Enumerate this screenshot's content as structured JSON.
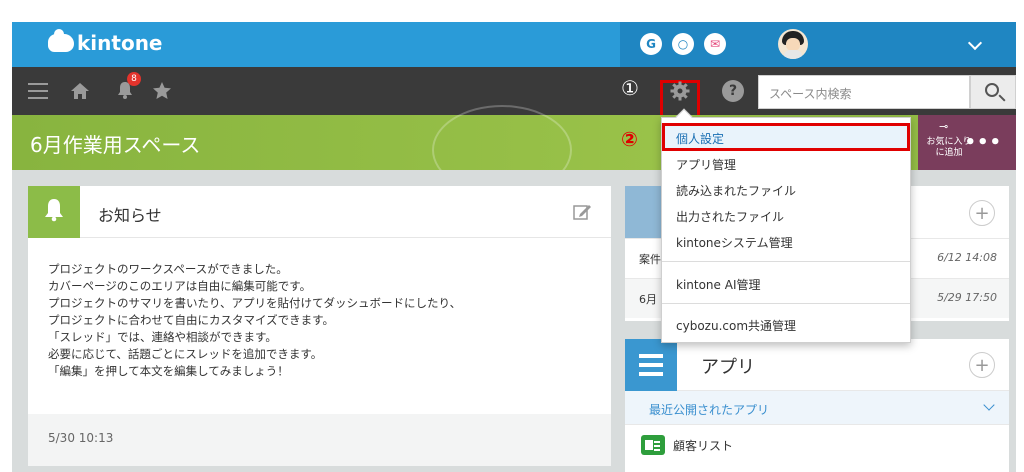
{
  "header": {
    "logo_text": "kintone",
    "services": [
      "G",
      "○",
      "✉"
    ],
    "brand_color": "#2a9bd8"
  },
  "nav": {
    "notification_count": "8",
    "marker_1": "①",
    "marker_2": "②",
    "help_glyph": "?",
    "search": {
      "placeholder": "スペース内検索"
    }
  },
  "space": {
    "title": "6月作業用スペース",
    "favorite_label": "お気に入り\nに追加",
    "more_glyph": "•••"
  },
  "notice": {
    "title": "お知らせ",
    "lines": [
      "プロジェクトのワークスペースができました。",
      "カバーページのこのエリアは自由に編集可能です。",
      "プロジェクトのサマリを書いたり、アプリを貼付けてダッシュボードにしたり、",
      "プロジェクトに合わせて自由にカスタマイズできます。",
      "「スレッド」では、連絡や相談ができます。",
      "必要に応じて、話題ごとにスレッドを追加できます。",
      "「編集」を押して本文を編集してみましょう！"
    ],
    "date": "5/30 10:13"
  },
  "threads": {
    "plus": "+",
    "rows": [
      {
        "title": "案件",
        "date": "6/12 14:08"
      },
      {
        "title": "6月",
        "date": "5/29 17:50"
      }
    ]
  },
  "apps": {
    "title": "アプリ",
    "plus": "+",
    "recent_label": "最近公開されたアプリ",
    "items": [
      "顧客リスト"
    ]
  },
  "dropdown": {
    "items": [
      {
        "label": "個人設定"
      },
      {
        "label": "アプリ管理"
      },
      {
        "label": "読み込まれたファイル"
      },
      {
        "label": "出力されたファイル"
      },
      {
        "label": "kintoneシステム管理"
      },
      {
        "label": "kintone AI管理"
      },
      {
        "label": "cybozu.com共通管理"
      }
    ]
  }
}
